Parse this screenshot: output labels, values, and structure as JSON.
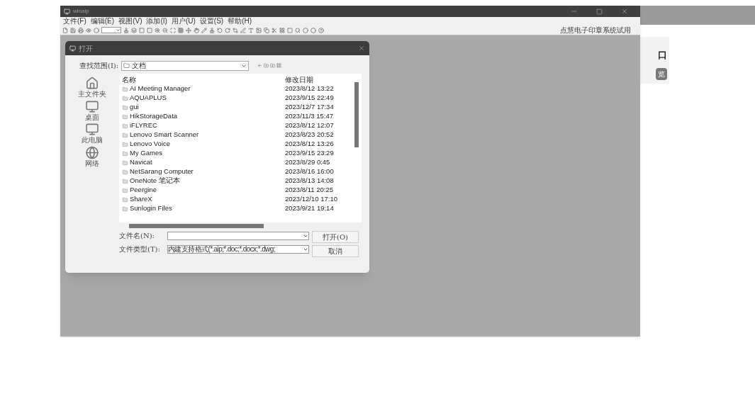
{
  "main_window": {
    "title": "winaip",
    "menu": [
      "文件(F)",
      "编辑(E)",
      "视图(V)",
      "添加(I)",
      "用户(U)",
      "设置(S)",
      "帮助(H)"
    ],
    "trial_note": "点慧电子印章系统试用"
  },
  "background_window": {
    "label": "口",
    "button": "览"
  },
  "dialog": {
    "title": "打开",
    "look_in_label": "查找范围(I):",
    "look_in_value": "文档",
    "places": [
      "主文件夹",
      "桌面",
      "此电脑",
      "网络"
    ],
    "columns": [
      "名称",
      "修改日期"
    ],
    "files": [
      {
        "name": "AI Meeting Manager",
        "date": "2023/8/12 13:22"
      },
      {
        "name": "AQUAPLUS",
        "date": "2023/9/15 22:49"
      },
      {
        "name": "gui",
        "date": "2023/12/7 17:34"
      },
      {
        "name": "HikStorageData",
        "date": "2023/11/3 15:47"
      },
      {
        "name": "iFLYREC",
        "date": "2023/8/12 12:07"
      },
      {
        "name": "Lenovo Smart Scanner",
        "date": "2023/8/23 20:52"
      },
      {
        "name": "Lenovo Voice",
        "date": "2023/8/12 13:26"
      },
      {
        "name": "My Games",
        "date": "2023/9/15 23:29"
      },
      {
        "name": "Navicat",
        "date": "2023/8/29 0:45"
      },
      {
        "name": "NetSarang Computer",
        "date": "2023/8/16 16:00"
      },
      {
        "name": "OneNote 笔记本",
        "date": "2023/8/13 14:08"
      },
      {
        "name": "Peergine",
        "date": "2023/8/11 20:25"
      },
      {
        "name": "ShareX",
        "date": "2023/12/10 17:10"
      },
      {
        "name": "Sunlogin Files",
        "date": "2023/9/21 19:14"
      }
    ],
    "filename_label": "文件名(N):",
    "filetype_label": "文件类型(T):",
    "filetype_value": "内建支持格式(*.aip;*.doc;*.docx;*.dwg;",
    "open_button": "打开(O)",
    "cancel_button": "取消"
  }
}
